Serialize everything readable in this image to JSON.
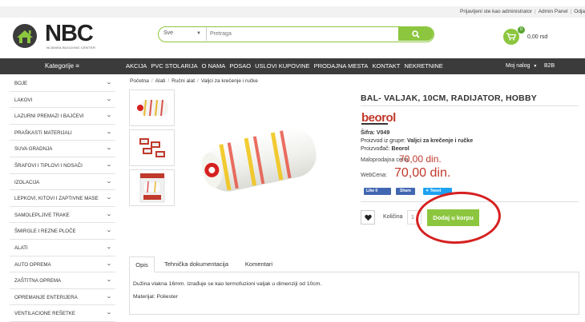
{
  "topbar": {
    "logged_in": "Prijavljeni ste kao administrator",
    "admin_panel": "Admin Panel",
    "logout": "Odja"
  },
  "logo": {
    "text": "NBC",
    "subtitle": "NIJANSA BUILDING CENTER"
  },
  "search": {
    "category": "Sve",
    "placeholder": "Pretraga"
  },
  "cart": {
    "count": "0",
    "amount": "0,00 rsd"
  },
  "nav": {
    "categories_label": "Kategorije ≡",
    "items": [
      "AKCIJA",
      "PVC STOLARIJA",
      "O NAMA",
      "POSAO",
      "USLOVI KUPOVINE",
      "PRODAJNA MESTA",
      "KONTAKT",
      "NEKRETNINE"
    ],
    "account": "Moj nalog",
    "b2b": "B2B"
  },
  "sidebar": {
    "items": [
      "BOJE",
      "LAKOVI",
      "LAZURNI PREMAZI I BAJĆEVI",
      "PRAŠKASTI MATERIJALI",
      "SUVA GRADNJA",
      "ŠRAFOVI I TIPLOVI I NOSAČI",
      "IZOLACIJA",
      "LEPKOVI, KITOVI I ZAPTIVNE MASE",
      "SAMOLEPLJIVE TRAKE",
      "ŠMIRGLE I REZNE PLOČE",
      "ALATI",
      "AUTO OPREMA",
      "ZAŠTITNA OPREMA",
      "OPREMANJE ENTERIJERA",
      "VENTILACIONE REŠETKE"
    ]
  },
  "breadcrumb": [
    "Početna",
    "Alati",
    "Ručni alat",
    "Valjci za krečenje i ručke"
  ],
  "product": {
    "title": "BAL- VALJAK, 10CM, RADIJATOR, HOBBY",
    "brand_logo": "beorol",
    "sku_label": "Šifra:",
    "sku": "V049",
    "group_label": "Proizvod iz grupe:",
    "group": "Valjci za krečenje i ručke",
    "maker_label": "Proizvođač:",
    "maker": "Beorol",
    "retail_label": "Maloprodajna cena:",
    "retail_price": "70,00 din.",
    "web_label": "WebCena:",
    "web_price": "70,00 din.",
    "qty_label": "Količina",
    "qty": "1",
    "add_button": "Dodaj u korpu"
  },
  "social": {
    "like": "Like 0",
    "share": "Share",
    "tweet": "Tweet"
  },
  "tabs": [
    "Opis",
    "Tehnička dokumentacija",
    "Komentari"
  ],
  "description": {
    "line1": "Dužina vlakna 16mm. Izrađuje se kao termofuzioni valjak u dimenziji od 10cm.",
    "line2": "Materijal: Poliester"
  },
  "colors": {
    "accent": "#8cc63f",
    "price": "#c0392b",
    "nav": "#3b3b3b",
    "highlight": "#d62020"
  }
}
